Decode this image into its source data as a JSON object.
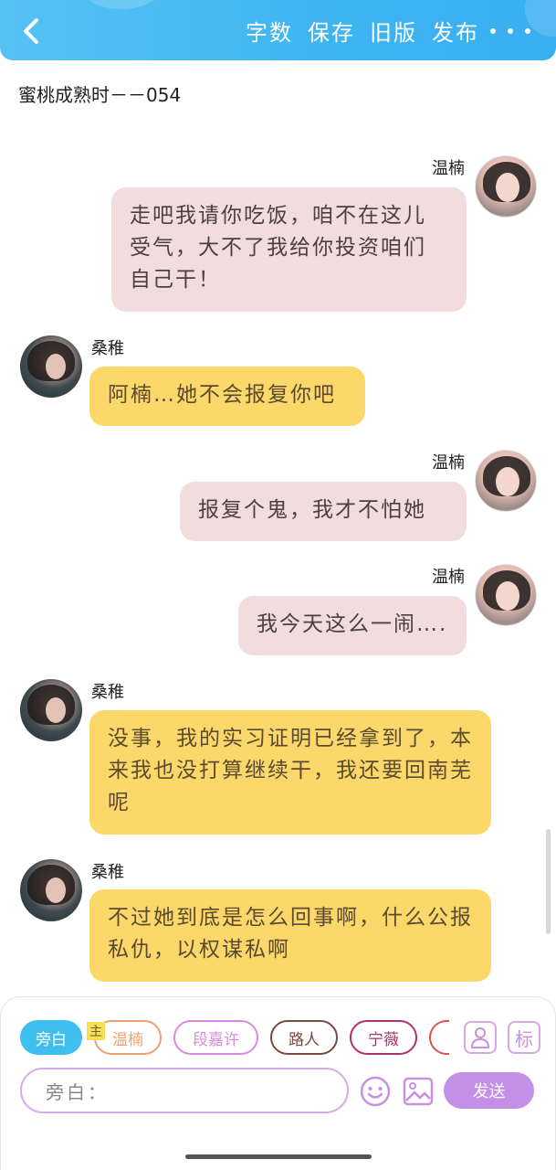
{
  "topbar": {
    "actions": [
      "字数",
      "保存",
      "旧版",
      "发布"
    ],
    "back_icon": "chevron-left-icon",
    "more_icon": "more-dots-icon"
  },
  "doc_title": "蜜桃成熟时－－054",
  "messages": [
    {
      "side": "right",
      "name": "温楠",
      "text": "走吧我请你吃饭，咱不在这儿受气，大不了我给你投资咱们自己干！"
    },
    {
      "side": "left",
      "name": "桑稚",
      "text": "阿楠…她不会报复你吧"
    },
    {
      "side": "right",
      "name": "温楠",
      "text": "报复个鬼，我才不怕她"
    },
    {
      "side": "right",
      "name": "温楠",
      "text": "我今天这么一闹…."
    },
    {
      "side": "left",
      "name": "桑稚",
      "text": "没事，我的实习证明已经拿到了，本来我也没打算继续干，我还要回南芜呢"
    },
    {
      "side": "left",
      "name": "桑稚",
      "text": "不过她到底是怎么回事啊，什么公报私仇，以权谋私啊"
    }
  ],
  "role_chips": [
    {
      "label": "旁白",
      "color": "#3fbef0",
      "active": true
    },
    {
      "label": "温楠",
      "color": "#f0a070",
      "badge": "主"
    },
    {
      "label": "段嘉许",
      "color": "#d98be0"
    },
    {
      "label": "路人",
      "color": "#7a4a40"
    },
    {
      "label": "宁薇",
      "color": "#b0306a"
    }
  ],
  "input": {
    "placeholder": "旁白："
  },
  "send_label": "发送",
  "icons": {
    "role": "person-card-icon",
    "tag": "tag-label-icon",
    "emoji": "emoji-icon",
    "image": "image-icon"
  },
  "tag_label": "标",
  "colors": {
    "topbar": "#3fb4f2",
    "bubble_right": "#f2dddd",
    "bubble_left": "#fcd86a",
    "send": "#c48fe6"
  }
}
